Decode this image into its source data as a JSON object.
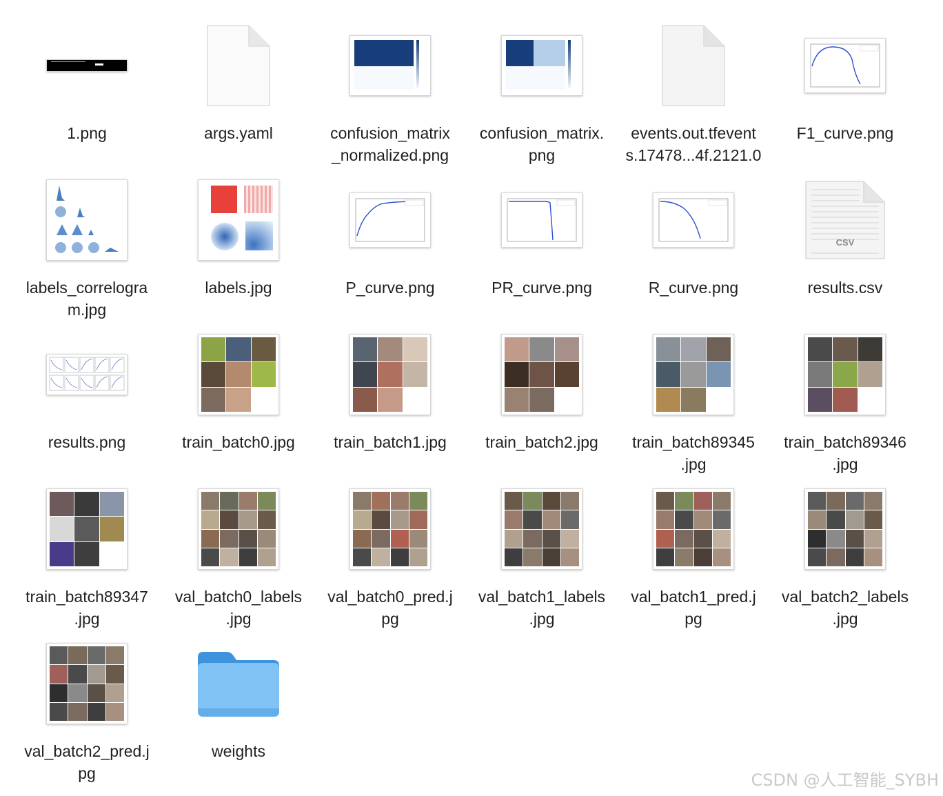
{
  "files": [
    {
      "name": "1.png",
      "type": "image-banner"
    },
    {
      "name": "args.yaml",
      "type": "document"
    },
    {
      "name": "confusion_matrix\n_normalized.png",
      "type": "confusion"
    },
    {
      "name": "confusion_matrix.\npng",
      "type": "confusion"
    },
    {
      "name": "events.out.tfevent\ns.17478...4f.2121.0",
      "type": "document"
    },
    {
      "name": "F1_curve.png",
      "type": "curve"
    },
    {
      "name": "labels_correlogra\nm.jpg",
      "type": "correlogram"
    },
    {
      "name": "labels.jpg",
      "type": "labels"
    },
    {
      "name": "P_curve.png",
      "type": "curve"
    },
    {
      "name": "PR_curve.png",
      "type": "curve"
    },
    {
      "name": "R_curve.png",
      "type": "curve"
    },
    {
      "name": "results.csv",
      "type": "csv"
    },
    {
      "name": "results.png",
      "type": "results"
    },
    {
      "name": "train_batch0.jpg",
      "type": "mosaic"
    },
    {
      "name": "train_batch1.jpg",
      "type": "mosaic"
    },
    {
      "name": "train_batch2.jpg",
      "type": "mosaic"
    },
    {
      "name": "train_batch89345\n.jpg",
      "type": "mosaic"
    },
    {
      "name": "train_batch89346\n.jpg",
      "type": "mosaic"
    },
    {
      "name": "train_batch89347\n.jpg",
      "type": "mosaic"
    },
    {
      "name": "val_batch0_labels\n.jpg",
      "type": "grid"
    },
    {
      "name": "val_batch0_pred.j\npg",
      "type": "grid"
    },
    {
      "name": "val_batch1_labels\n.jpg",
      "type": "grid"
    },
    {
      "name": "val_batch1_pred.j\npg",
      "type": "grid"
    },
    {
      "name": "val_batch2_labels\n.jpg",
      "type": "grid"
    },
    {
      "name": "val_batch2_pred.j\npg",
      "type": "grid"
    },
    {
      "name": "weights",
      "type": "folder"
    }
  ],
  "csv_badge": "CSV",
  "watermark": "CSDN @人工智能_SYBH"
}
